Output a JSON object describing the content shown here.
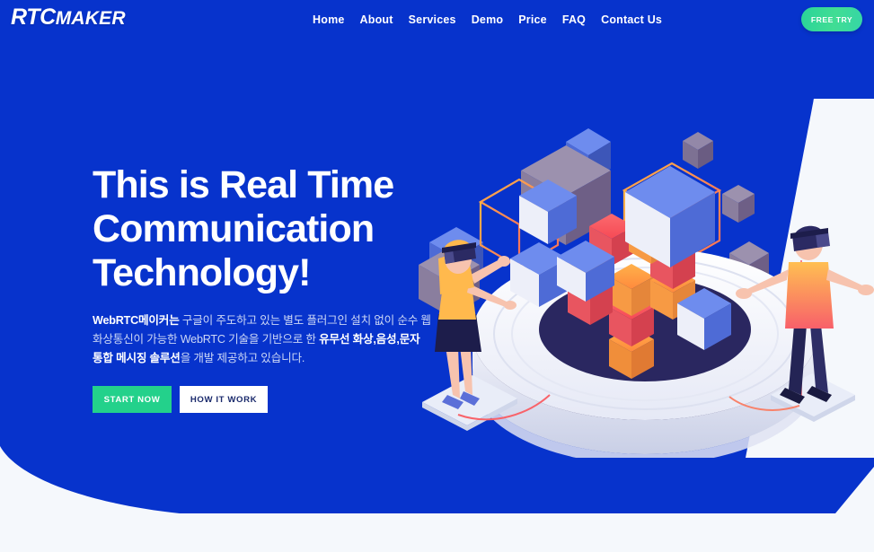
{
  "brand": {
    "logo_main": "RTC",
    "logo_sub": "MAKER"
  },
  "colors": {
    "hero_blue": "#0733CC",
    "page_bg": "#F5F8FC",
    "accent_green": "#23D18B",
    "free_try_gradient_start": "#2AD499",
    "free_try_gradient_end": "#35D6A6",
    "headline_white": "#FFFFFF",
    "subcopy_muted": "#CDD8F6",
    "cube_blue": "#5B79E8",
    "cube_purple": "#7E6F93",
    "cube_orange": "#FF9A3C",
    "cube_red": "#F9565B",
    "platform_white": "#F3F4FB",
    "platform_well": "#2A2760"
  },
  "nav": {
    "items": [
      {
        "label": "Home",
        "name": "nav-link-home"
      },
      {
        "label": "About",
        "name": "nav-link-about"
      },
      {
        "label": "Services",
        "name": "nav-link-services"
      },
      {
        "label": "Demo",
        "name": "nav-link-demo"
      },
      {
        "label": "Price",
        "name": "nav-link-price"
      },
      {
        "label": "FAQ",
        "name": "nav-link-faq"
      },
      {
        "label": "Contact Us",
        "name": "nav-link-contact-us"
      }
    ],
    "cta_label": "FREE TRY"
  },
  "hero": {
    "headline_line1": "This is Real Time",
    "headline_line2": "Communication",
    "headline_line3": "Technology!",
    "subcopy_bold_1": "WebRTC메이커는",
    "subcopy_normal_1": " 구글이 주도하고 있는 별도 플러그인 설치 없이 순수 웹 화상통신이 가능한 WebRTC 기술을 기반으로 한 ",
    "subcopy_bold_2": "유무선 화상,음성,문자 통합 메시징 솔루션",
    "subcopy_normal_2": "을 개발 제공하고 있습니다.",
    "cta_primary": "START NOW",
    "cta_secondary": "HOW IT WORK",
    "illustration_alt": "isometric-vr-cubes-platform"
  }
}
